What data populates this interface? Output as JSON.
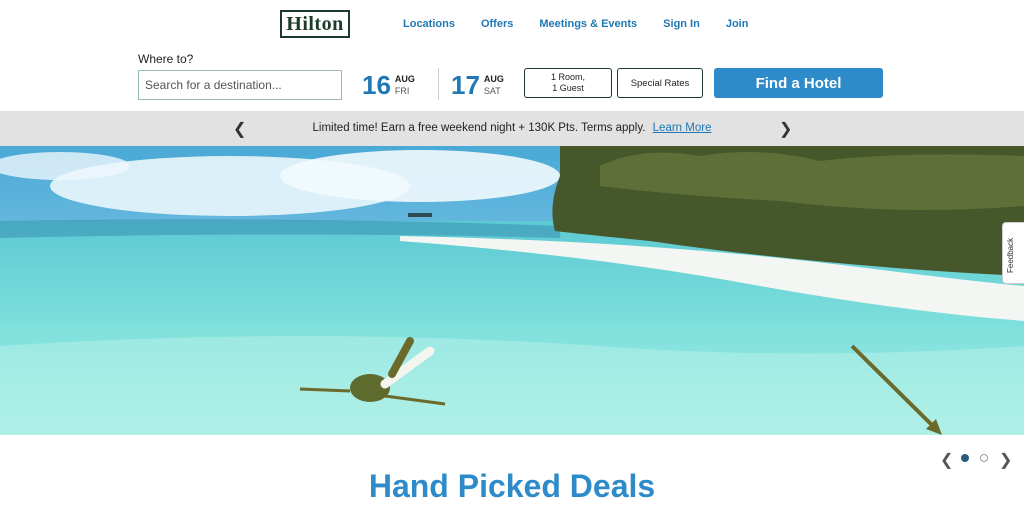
{
  "brand": {
    "logo_text": "Hilton"
  },
  "nav": {
    "items": [
      "Locations",
      "Offers",
      "Meetings & Events",
      "Sign In",
      "Join"
    ]
  },
  "search": {
    "label": "Where to?",
    "placeholder": "Search for a destination...",
    "checkin": {
      "day": "16",
      "month": "AUG",
      "weekday": "FRI"
    },
    "checkout": {
      "day": "17",
      "month": "AUG",
      "weekday": "SAT"
    },
    "rooms_line1": "1 Room,",
    "rooms_line2": "1 Guest",
    "special_rates": "Special Rates",
    "find_button": "Find a Hotel"
  },
  "promo": {
    "text": "Limited time! Earn a free weekend night + 130K Pts. Terms apply.",
    "link": "Learn More",
    "prev_icon": "chevron-left-icon",
    "next_icon": "chevron-right-icon"
  },
  "feedback": {
    "label": "Feedback"
  },
  "carousel": {
    "slide_count": 2,
    "active_slide": 1
  },
  "section": {
    "title": "Hand Picked Deals"
  },
  "colors": {
    "accent": "#2e8bc9",
    "link": "#1f78b4",
    "brand": "#1d3b2a",
    "banner": "#e2e2e2"
  }
}
